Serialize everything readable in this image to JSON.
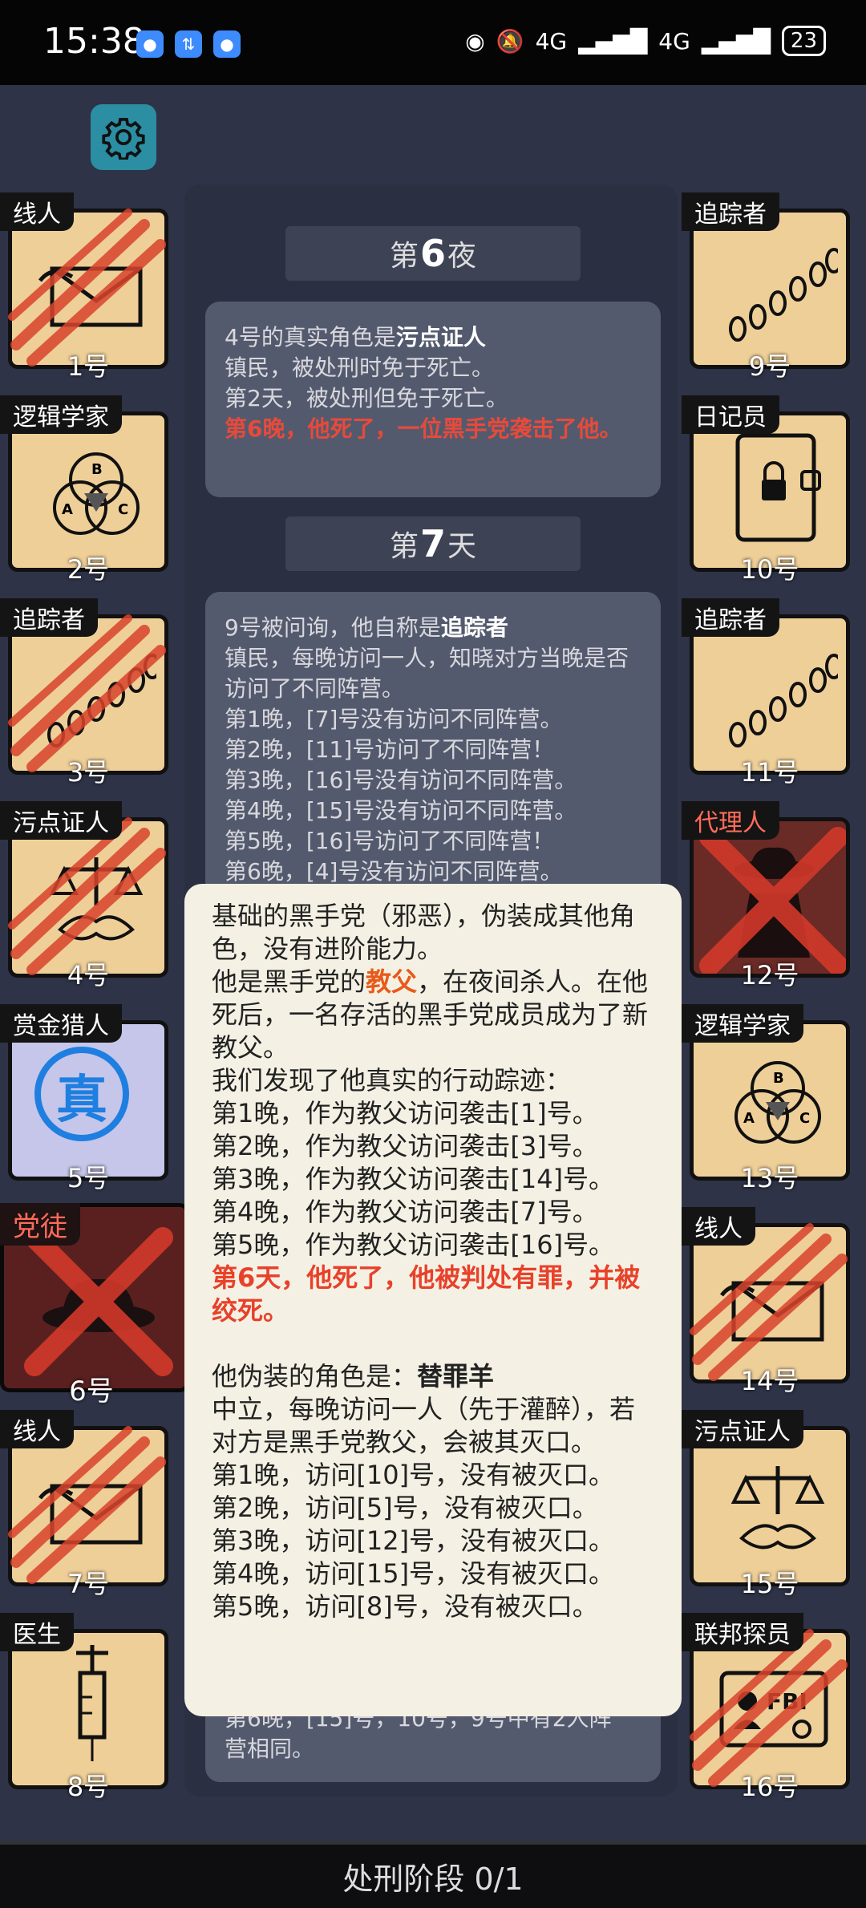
{
  "status_bar": {
    "time": "15:38",
    "network1": "4G",
    "network2": "4G",
    "battery": "23"
  },
  "headers": {
    "night6_prefix": "第",
    "night6_num": "6",
    "night6_suffix": "夜",
    "day7_prefix": "第",
    "day7_num": "7",
    "day7_suffix": "天"
  },
  "card1": {
    "line1_prefix": "4号的真实角色是",
    "line1_role": "污点证人",
    "line2": "镇民，被处刑时免于死亡。",
    "line3": "第2天，被处刑但免于死亡。",
    "line4": "第6晚，他死了，一位黑手党袭击了他。"
  },
  "card2": {
    "line1_prefix": "9号被问询，他自称是",
    "line1_role": "追踪者",
    "line2": "镇民，每晚访问一人，知晓对方当晚是否访问了不同阵营。",
    "lines": [
      "第1晚，[7]号没有访问不同阵营。",
      "第2晚，[11]号访问了不同阵营！",
      "第3晚，[16]号没有访问不同阵营。",
      "第4晚，[15]号没有访问不同阵营。",
      "第5晚，[16]号访问了不同阵营！",
      "第6晚，[4]号没有访问不同阵营。"
    ]
  },
  "card3": {
    "line1": "第6晚，[15]号，10号，9号中有2人阵",
    "line2": "营相同。"
  },
  "popup": {
    "p1": "基础的黑手党（邪恶），伪装成其他角色，没有进阶能力。",
    "p2_prefix": "他是黑手党的",
    "p2_role": "教父",
    "p2_suffix": "，在夜间杀人。在他死后，一名存活的黑手党成员成为了新教父。",
    "p3": "我们发现了他真实的行动踪迹：",
    "actions": [
      "第1晚，作为教父访问袭击[1]号。",
      "第2晚，作为教父访问袭击[3]号。",
      "第3晚，作为教父访问袭击[14]号。",
      "第4晚，作为教父访问袭击[7]号。",
      "第5晚，作为教父访问袭击[16]号。"
    ],
    "death": "第6天，他死了，他被判处有罪，并被绞死。",
    "disguise_prefix": "他伪装的角色是：",
    "disguise_role": "替罪羊",
    "disguise_desc": "中立，每晚访问一人（先于灌醉），若对方是黑手党教父，会被其灭口。",
    "visits": [
      "第1晚，访问[10]号，没有被灭口。",
      "第2晚，访问[5]号，没有被灭口。",
      "第3晚，访问[12]号，没有被灭口。",
      "第4晚，访问[15]号，没有被灭口。",
      "第5晚，访问[8]号，没有被灭口。"
    ]
  },
  "players": {
    "p1": {
      "role": "线人",
      "num": "1号"
    },
    "p2": {
      "role": "逻辑学家",
      "num": "2号"
    },
    "p3": {
      "role": "追踪者",
      "num": "3号"
    },
    "p4": {
      "role": "污点证人",
      "num": "4号"
    },
    "p5": {
      "role": "赏金猎人",
      "num": "5号",
      "stamp": "真"
    },
    "p6": {
      "role": "党徒",
      "num": "6号"
    },
    "p7": {
      "role": "线人",
      "num": "7号"
    },
    "p8": {
      "role": "医生",
      "num": "8号"
    },
    "p9": {
      "role": "追踪者",
      "num": "9号"
    },
    "p10": {
      "role": "日记员",
      "num": "10号"
    },
    "p11": {
      "role": "追踪者",
      "num": "11号"
    },
    "p12": {
      "role": "代理人",
      "num": "12号"
    },
    "p13": {
      "role": "逻辑学家",
      "num": "13号"
    },
    "p14": {
      "role": "线人",
      "num": "14号"
    },
    "p15": {
      "role": "污点证人",
      "num": "15号"
    },
    "p16": {
      "role": "联邦探员",
      "num": "16号"
    }
  },
  "bottom_bar": {
    "phase": "处刑阶段 0/1"
  },
  "colors": {
    "accent_red": "#e84a3a",
    "card_bg": "#efcf98",
    "popup_bg": "#f4f1e4"
  }
}
